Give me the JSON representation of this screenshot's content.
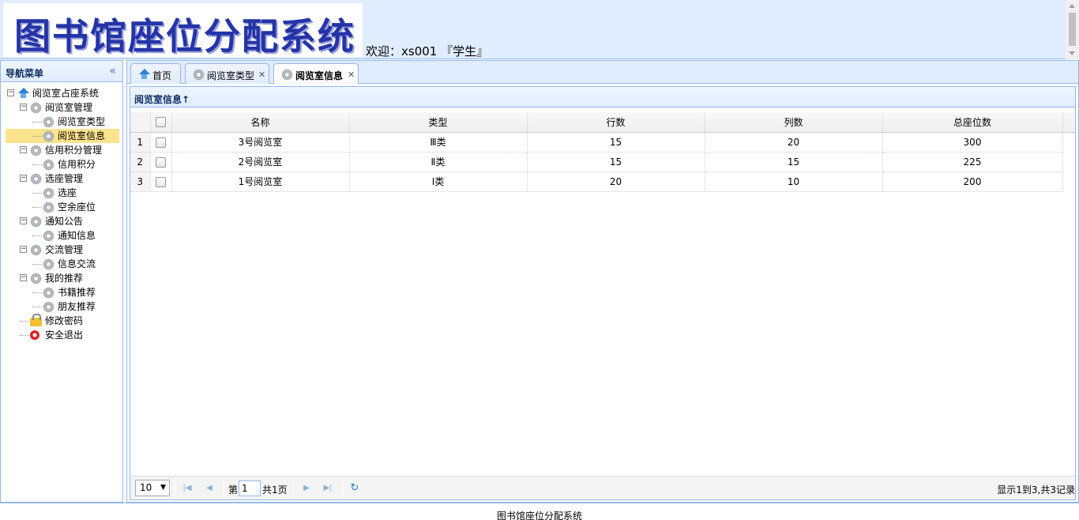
{
  "header": {
    "logo_text": "图书馆座位分配系统",
    "welcome": "欢迎：xs001 『学生』"
  },
  "sidebar": {
    "title": "导航菜单",
    "collapse_icon": "double-chevron-left-icon",
    "tree": [
      {
        "label": "阅览室占座系统",
        "icon": "home-icon",
        "level": 0
      },
      {
        "label": "阅览室管理",
        "icon": "gear-icon",
        "level": 1
      },
      {
        "label": "阅览室类型",
        "icon": "gear-icon",
        "level": 2
      },
      {
        "label": "阅览室信息",
        "icon": "gear-icon",
        "level": 2,
        "selected": true
      },
      {
        "label": "信用积分管理",
        "icon": "gear-icon",
        "level": 1
      },
      {
        "label": "信用积分",
        "icon": "gear-icon",
        "level": 2
      },
      {
        "label": "选座管理",
        "icon": "gear-icon",
        "level": 1
      },
      {
        "label": "选座",
        "icon": "gear-icon",
        "level": 2
      },
      {
        "label": "空余座位",
        "icon": "gear-icon",
        "level": 2
      },
      {
        "label": "通知公告",
        "icon": "gear-icon",
        "level": 1
      },
      {
        "label": "通知信息",
        "icon": "gear-icon",
        "level": 2
      },
      {
        "label": "交流管理",
        "icon": "gear-icon",
        "level": 1
      },
      {
        "label": "信息交流",
        "icon": "gear-icon",
        "level": 2
      },
      {
        "label": "我的推荐",
        "icon": "gear-icon",
        "level": 1
      },
      {
        "label": "书籍推荐",
        "icon": "gear-icon",
        "level": 2
      },
      {
        "label": "朋友推荐",
        "icon": "gear-icon",
        "level": 2
      },
      {
        "label": "修改密码",
        "icon": "lock-icon",
        "level": 1
      },
      {
        "label": "安全退出",
        "icon": "exit-icon",
        "level": 1
      }
    ]
  },
  "tabs": [
    {
      "label": "首页",
      "icon": "home-icon",
      "closable": false
    },
    {
      "label": "阅览室类型",
      "icon": "gear-icon",
      "closable": true
    },
    {
      "label": "阅览室信息",
      "icon": "gear-icon",
      "closable": true,
      "active": true
    }
  ],
  "grid": {
    "title": "阅览室信息↑",
    "columns": [
      "名称",
      "类型",
      "行数",
      "列数",
      "总座位数"
    ],
    "rows": [
      {
        "num": "1",
        "name": "3号阅览室",
        "type": "Ⅲ类",
        "rows": "15",
        "cols": "20",
        "total": "300"
      },
      {
        "num": "2",
        "name": "2号阅览室",
        "type": "Ⅱ类",
        "rows": "15",
        "cols": "15",
        "total": "225"
      },
      {
        "num": "3",
        "name": "1号阅览室",
        "type": "Ⅰ类",
        "rows": "20",
        "cols": "10",
        "total": "200"
      }
    ]
  },
  "pager": {
    "page_size": "10",
    "page_label_pre": "第",
    "page_number": "1",
    "page_total": "共1页",
    "info": "显示1到3,共3记录"
  },
  "footer": {
    "text": "图书馆座位分配系统"
  },
  "colors": {
    "header_bg": "#e0ecff",
    "border": "#95b8e7",
    "selected_bg": "#ffe48d",
    "logo_text": "#2434a8"
  }
}
